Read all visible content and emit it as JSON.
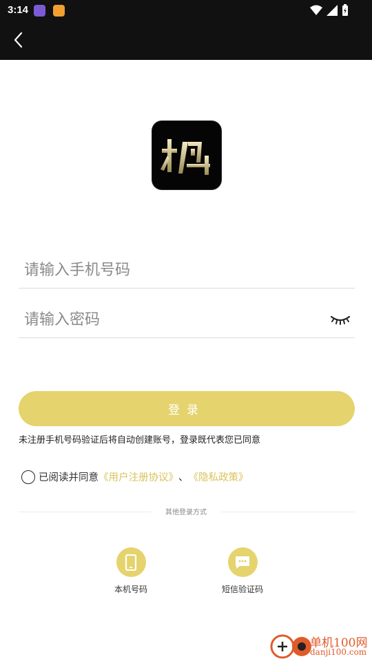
{
  "status_bar": {
    "time": "3:14"
  },
  "form": {
    "phone_placeholder": "请输入手机号码",
    "password_placeholder": "请输入密码",
    "login_label": "登录",
    "notice": "未注册手机号码验证后将自动创建账号，登录既代表您已同意",
    "agree_prefix": "已阅读并同意",
    "user_agreement": "《用户注册协议》",
    "separator": "、",
    "privacy_policy": "《隐私政策》"
  },
  "other_login": {
    "title": "其他登录方式",
    "local_number": "本机号码",
    "sms_code": "短信验证码"
  },
  "watermark": {
    "name": "单机100网",
    "domain": "danji100.com"
  },
  "colors": {
    "accent": "#e5d36d",
    "link": "#d9c35a",
    "bar": "#111111"
  }
}
